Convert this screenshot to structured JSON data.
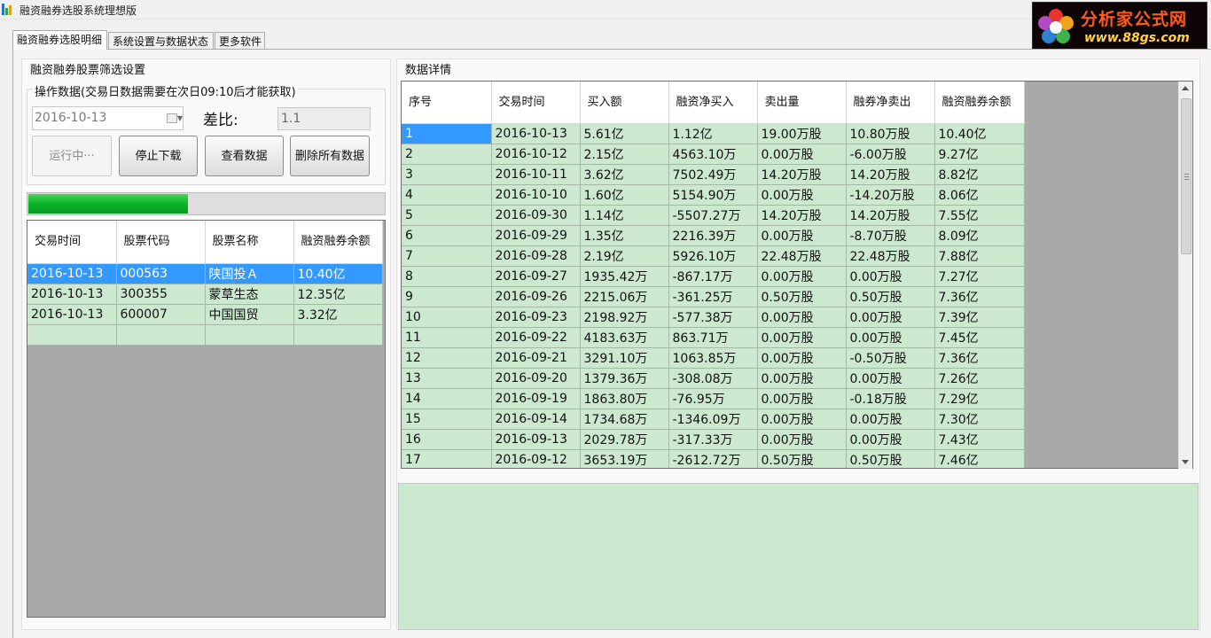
{
  "window": {
    "title": "融资融券选股系统理想版"
  },
  "logo": {
    "brand": "分析家公式网",
    "url": "www.88gs.com"
  },
  "tabs": [
    {
      "label": "融资融券选股明细"
    },
    {
      "label": "系统设置与数据状态"
    },
    {
      "label": "更多软件"
    }
  ],
  "left": {
    "title": "融资融券股票筛选设置",
    "group_label": "操作数据(交易日数据需要在次日09:10后才能获取)",
    "date_value": "2016-10-13",
    "ratio_label": "差比:",
    "ratio_value": "1.1",
    "buttons": {
      "running": "运行中···",
      "stop": "停止下载",
      "view": "查看数据",
      "delete": "删除所有数据"
    },
    "progress": 0.45,
    "grid": {
      "headers": [
        "交易时间",
        "股票代码",
        "股票名称",
        "融资融券余额"
      ],
      "rows": [
        [
          "2016-10-13",
          "000563",
          "陕国投Ａ",
          "10.40亿"
        ],
        [
          "2016-10-13",
          "300355",
          "蒙草生态",
          "12.35亿"
        ],
        [
          "2016-10-13",
          "600007",
          "中国国贸",
          "3.32亿"
        ]
      ]
    }
  },
  "right": {
    "title": "数据详情",
    "headers": [
      "序号",
      "交易时间",
      "买入额",
      "融资净买入",
      "卖出量",
      "融券净卖出",
      "融资融券余额"
    ],
    "rows": [
      [
        "1",
        "2016-10-13",
        "5.61亿",
        "1.12亿",
        "19.00万股",
        "10.80万股",
        "10.40亿"
      ],
      [
        "2",
        "2016-10-12",
        "2.15亿",
        "4563.10万",
        "0.00万股",
        "-6.00万股",
        "9.27亿"
      ],
      [
        "3",
        "2016-10-11",
        "3.62亿",
        "7502.49万",
        "14.20万股",
        "14.20万股",
        "8.82亿"
      ],
      [
        "4",
        "2016-10-10",
        "1.60亿",
        "5154.90万",
        "0.00万股",
        "-14.20万股",
        "8.06亿"
      ],
      [
        "5",
        "2016-09-30",
        "1.14亿",
        "-5507.27万",
        "14.20万股",
        "14.20万股",
        "7.55亿"
      ],
      [
        "6",
        "2016-09-29",
        "1.35亿",
        "2216.39万",
        "0.00万股",
        "-8.70万股",
        "8.09亿"
      ],
      [
        "7",
        "2016-09-28",
        "2.19亿",
        "5926.10万",
        "22.48万股",
        "22.48万股",
        "7.88亿"
      ],
      [
        "8",
        "2016-09-27",
        "1935.42万",
        "-867.17万",
        "0.00万股",
        "0.00万股",
        "7.27亿"
      ],
      [
        "9",
        "2016-09-26",
        "2215.06万",
        "-361.25万",
        "0.50万股",
        "0.50万股",
        "7.36亿"
      ],
      [
        "10",
        "2016-09-23",
        "2198.92万",
        "-577.38万",
        "0.00万股",
        "0.00万股",
        "7.39亿"
      ],
      [
        "11",
        "2016-09-22",
        "4183.63万",
        "863.71万",
        "0.00万股",
        "0.00万股",
        "7.45亿"
      ],
      [
        "12",
        "2016-09-21",
        "3291.10万",
        "1063.85万",
        "0.00万股",
        "-0.50万股",
        "7.36亿"
      ],
      [
        "13",
        "2016-09-20",
        "1379.36万",
        "-308.08万",
        "0.00万股",
        "0.00万股",
        "7.26亿"
      ],
      [
        "14",
        "2016-09-19",
        "1863.80万",
        "-76.95万",
        "0.00万股",
        "-0.18万股",
        "7.29亿"
      ],
      [
        "15",
        "2016-09-14",
        "1734.68万",
        "-1346.09万",
        "0.00万股",
        "0.00万股",
        "7.30亿"
      ],
      [
        "16",
        "2016-09-13",
        "2029.78万",
        "-317.33万",
        "0.00万股",
        "0.00万股",
        "7.43亿"
      ],
      [
        "17",
        "2016-09-12",
        "3653.19万",
        "-2612.72万",
        "0.50万股",
        "0.50万股",
        "7.46亿"
      ]
    ]
  },
  "colors": {
    "cell_green": "#cce8cf",
    "selection_blue": "#3399ff",
    "grid_background": "#a9a9a9",
    "progress_green": "#0cb429"
  }
}
